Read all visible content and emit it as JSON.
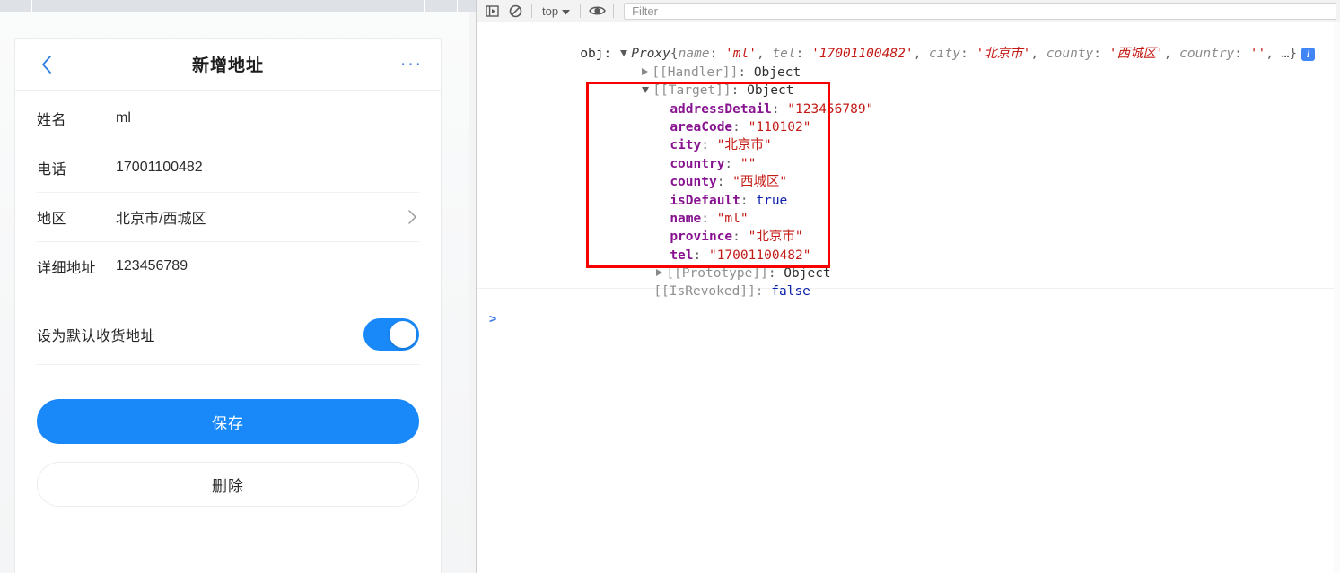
{
  "browser": {
    "tabstrip_present": true
  },
  "mobile_page": {
    "header": {
      "back_icon": "chevron-left-icon",
      "title": "新增地址",
      "more_label": "···"
    },
    "fields": [
      {
        "label": "姓名",
        "value": "ml",
        "chevron": false
      },
      {
        "label": "电话",
        "value": "17001100482",
        "chevron": false
      },
      {
        "label": "地区",
        "value": "北京市/西城区",
        "chevron": true
      },
      {
        "label": "详细地址",
        "value": "123456789",
        "chevron": false
      }
    ],
    "default_switch": {
      "label": "设为默认收货地址",
      "state": "on",
      "on_color": "#1989fa"
    },
    "buttons": {
      "save_label": "保存",
      "delete_label": "删除",
      "primary_color": "#1989fa"
    }
  },
  "devtools": {
    "toolbar": {
      "drawer_icon": "console-drawer-icon",
      "clear_icon": "clear-console-icon",
      "context_label": "top",
      "context_caret": "▼",
      "eye_icon": "eye-icon",
      "filter_placeholder": "Filter"
    },
    "console": {
      "variable_label": "obj:",
      "proxy_label": "Proxy",
      "preview": {
        "open_brace": "{",
        "entries": [
          {
            "key": "name",
            "value": "'ml'"
          },
          {
            "key": "tel",
            "value": "'17001100482'"
          },
          {
            "key": "city",
            "value": "'北京市'"
          },
          {
            "key": "county",
            "value": "'西城区'"
          },
          {
            "key": "country",
            "value": "''"
          }
        ],
        "ellipsis": "…",
        "close_brace": "}",
        "info_badge": "i"
      },
      "internal_slots": [
        {
          "name": "[[Handler]]",
          "type": "Object",
          "expanded": false
        },
        {
          "name": "[[Target]]",
          "type": "Object",
          "expanded": true
        }
      ],
      "target_properties": [
        {
          "key": "addressDetail",
          "value": "\"123456789\"",
          "kind": "string"
        },
        {
          "key": "areaCode",
          "value": "\"110102\"",
          "kind": "string"
        },
        {
          "key": "city",
          "value": "\"北京市\"",
          "kind": "string"
        },
        {
          "key": "country",
          "value": "\"\"",
          "kind": "string"
        },
        {
          "key": "county",
          "value": "\"西城区\"",
          "kind": "string"
        },
        {
          "key": "isDefault",
          "value": "true",
          "kind": "boolean"
        },
        {
          "key": "name",
          "value": "\"ml\"",
          "kind": "string"
        },
        {
          "key": "province",
          "value": "\"北京市\"",
          "kind": "string"
        },
        {
          "key": "tel",
          "value": "\"17001100482\"",
          "kind": "string"
        }
      ],
      "prototype_row": {
        "name": "[[Prototype]]",
        "type": "Object"
      },
      "revoked_row": {
        "name": "[[IsRevoked]]:",
        "value": "false"
      },
      "prompt_caret": ">",
      "annotation_color": "#f60000"
    }
  }
}
